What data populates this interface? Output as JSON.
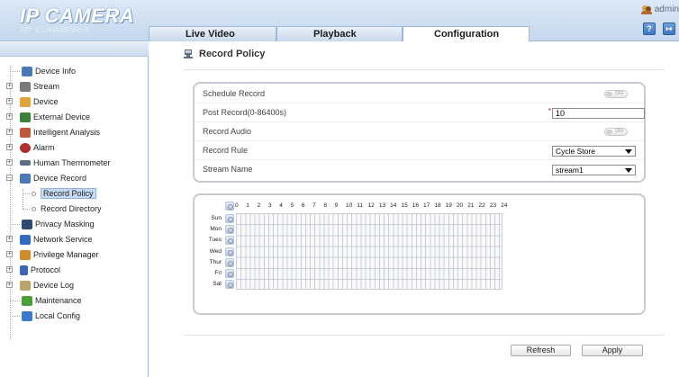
{
  "app": {
    "logo": "IP CAMERA",
    "user": "admin"
  },
  "icons": {
    "user": "user-group-icon",
    "help": "help-icon",
    "logout": "logout-icon",
    "record_policy": "record-policy-icon"
  },
  "tabs": [
    {
      "label": "Live Video",
      "active": false
    },
    {
      "label": "Playback",
      "active": false
    },
    {
      "label": "Configuration",
      "active": true
    }
  ],
  "sidebar": {
    "items": [
      {
        "label": "Device Info",
        "icon": "device-info-icon",
        "color": "#4a79b8"
      },
      {
        "label": "Stream",
        "icon": "stream-icon",
        "color": "#7a7a7a"
      },
      {
        "label": "Device",
        "icon": "device-icon",
        "color": "#e2a33a"
      },
      {
        "label": "External Device",
        "icon": "external-device-icon",
        "color": "#3a7f3a"
      },
      {
        "label": "Intelligent Analysis",
        "icon": "intelligent-analysis-icon",
        "color": "#c0563a"
      },
      {
        "label": "Alarm",
        "icon": "alarm-icon",
        "color": "#b03030"
      },
      {
        "label": "Human Thermometer",
        "icon": "thermometer-icon",
        "color": "#5a6d86"
      },
      {
        "label": "Device Record",
        "icon": "device-record-icon",
        "color": "#4a79b8"
      },
      {
        "label": "Record Policy",
        "icon": "leaf-icon",
        "selected": true
      },
      {
        "label": "Record Directory",
        "icon": "leaf-icon"
      },
      {
        "label": "Privacy Masking",
        "icon": "privacy-masking-icon",
        "color": "#2f4a70"
      },
      {
        "label": "Network Service",
        "icon": "network-service-icon",
        "color": "#2f6cbf"
      },
      {
        "label": "Privilege Manager",
        "icon": "privilege-manager-icon",
        "color": "#d08a2a"
      },
      {
        "label": "Protocol",
        "icon": "protocol-icon",
        "color": "#3d66b0"
      },
      {
        "label": "Device Log",
        "icon": "device-log-icon",
        "color": "#b9a46e"
      },
      {
        "label": "Maintenance",
        "icon": "maintenance-icon",
        "color": "#4aa03a"
      },
      {
        "label": "Local Config",
        "icon": "local-config-icon",
        "color": "#3a7ac8"
      }
    ]
  },
  "main": {
    "title": "Record Policy",
    "settings": {
      "schedule_record": {
        "label": "Schedule Record",
        "toggle": "OFF"
      },
      "post_record": {
        "label": "Post Record(0-86400s)",
        "value": "10",
        "required_mark": "*"
      },
      "record_audio": {
        "label": "Record Audio",
        "toggle": "OFF"
      },
      "record_rule": {
        "label": "Record Rule",
        "value": "Cycle Store"
      },
      "stream_name": {
        "label": "Stream Name",
        "value": "stream1"
      }
    },
    "schedule": {
      "hours": [
        "0",
        "1",
        "2",
        "3",
        "4",
        "5",
        "6",
        "7",
        "8",
        "9",
        "10",
        "11",
        "12",
        "13",
        "14",
        "15",
        "16",
        "17",
        "18",
        "19",
        "20",
        "21",
        "22",
        "23",
        "24"
      ],
      "days": [
        "Sun",
        "Mon",
        "Tues",
        "Wed",
        "Thur",
        "Fri",
        "Sat"
      ]
    },
    "buttons": {
      "refresh": "Refresh",
      "apply": "Apply"
    }
  }
}
